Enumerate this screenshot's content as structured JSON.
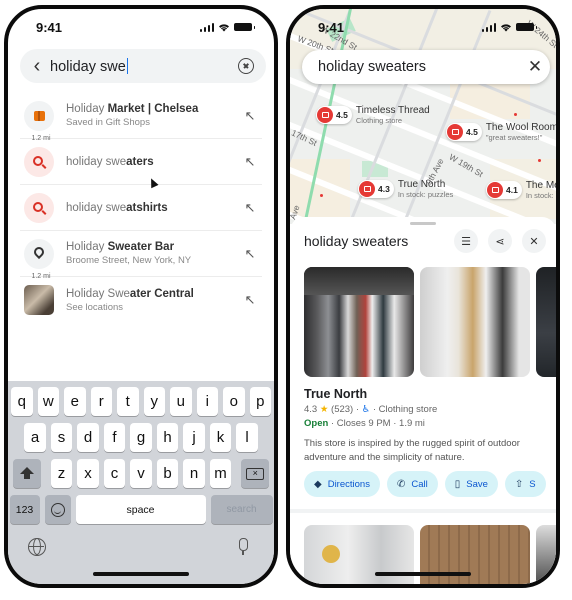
{
  "status_bar": {
    "time": "9:41"
  },
  "left_phone": {
    "search": {
      "query": "holiday swe"
    },
    "suggestions": [
      {
        "icon": "gift-icon",
        "title_prefix": "Holiday ",
        "title_bold": "Market | Chelsea",
        "subtitle": "Saved in Gift Shops",
        "distance": "1.2 mi"
      },
      {
        "icon": "search-icon",
        "title_prefix": "holiday swe",
        "title_bold": "aters",
        "subtitle": "",
        "distance": ""
      },
      {
        "icon": "search-icon",
        "title_prefix": "holiday swe",
        "title_bold": "atshirts",
        "subtitle": "",
        "distance": ""
      },
      {
        "icon": "location-pin-icon",
        "title_prefix": "Holiday ",
        "title_bold": "Sweater Bar",
        "subtitle": "Broome Street, New York, NY",
        "distance": "1.2 mi"
      },
      {
        "icon": "place-photo",
        "title_prefix": "Holiday Swe",
        "title_bold": "ater Central",
        "subtitle": "See locations",
        "distance": ""
      }
    ],
    "keyboard": {
      "row1": [
        "q",
        "w",
        "e",
        "r",
        "t",
        "y",
        "u",
        "i",
        "o",
        "p"
      ],
      "row2": [
        "a",
        "s",
        "d",
        "f",
        "g",
        "h",
        "j",
        "k",
        "l"
      ],
      "row3": [
        "z",
        "x",
        "c",
        "v",
        "b",
        "n",
        "m"
      ],
      "numbers_key": "123",
      "space_key": "space",
      "search_key": "search"
    }
  },
  "right_phone": {
    "search": {
      "query": "holiday sweaters"
    },
    "map": {
      "streets": [
        "W 22nd St",
        "W 20th St",
        "W 24th St",
        "17th St",
        "W 19th St",
        "9th Ave",
        "Ave"
      ],
      "pins": [
        {
          "rating": "4.5",
          "name": "Timeless Thread",
          "subtitle": "Clothing store"
        },
        {
          "rating": "4.5",
          "name": "The Wool Room",
          "subtitle": "\"great sweaters!\""
        },
        {
          "rating": "4.3",
          "name": "True North",
          "subtitle": "In stock: puzzles"
        },
        {
          "rating": "4.1",
          "name": "The Me",
          "subtitle": "In stock:"
        }
      ]
    },
    "sheet": {
      "title": "holiday sweaters",
      "place": {
        "name": "True North",
        "rating": "4.3",
        "reviews": "(523)",
        "accessibility": "♿",
        "category": "Clothing store",
        "open_status": "Open",
        "hours": "Closes 9 PM",
        "distance": "1.9 mi",
        "description": "This store is inspired by the rugged spirit of outdoor adventure and the simplicity of nature."
      },
      "actions": [
        {
          "icon": "directions-icon",
          "label": "Directions"
        },
        {
          "icon": "phone-icon",
          "label": "Call"
        },
        {
          "icon": "bookmark-icon",
          "label": "Save"
        },
        {
          "icon": "share-icon",
          "label": "S"
        }
      ]
    }
  }
}
